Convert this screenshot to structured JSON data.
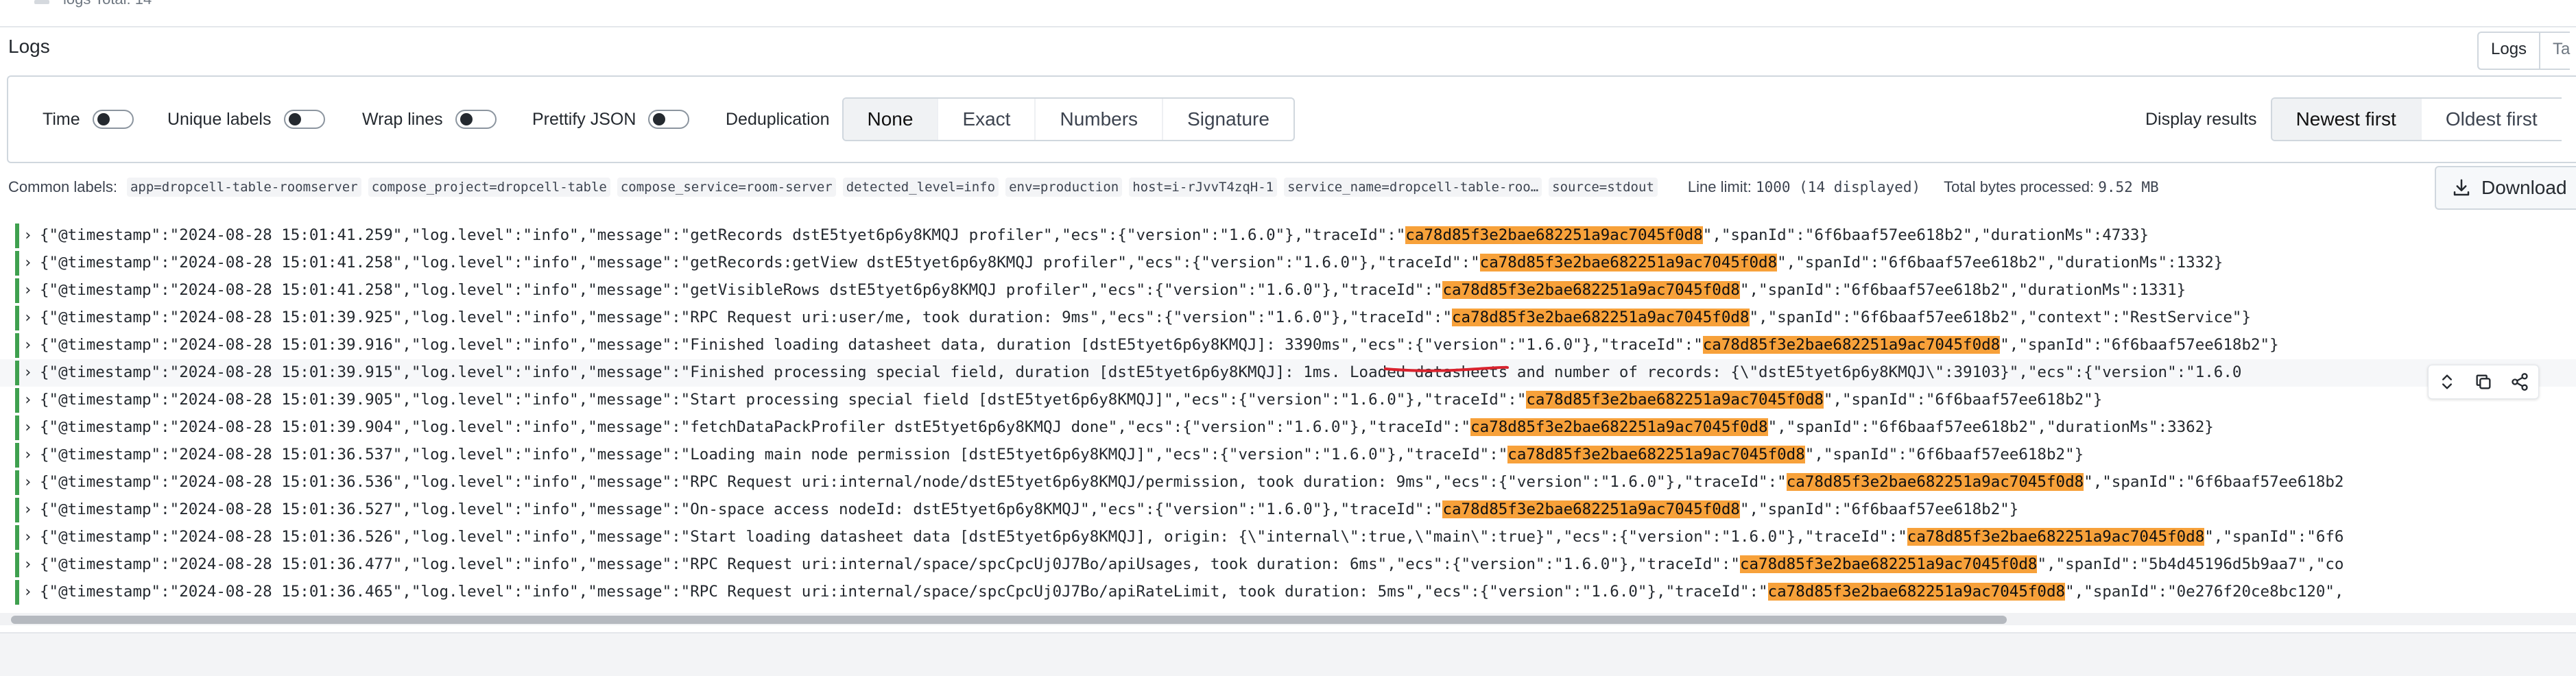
{
  "top_strip": {
    "legend_text": "logs   Total: 14"
  },
  "panel": {
    "title": "Logs"
  },
  "view_tabs": [
    "Logs",
    "Ta"
  ],
  "controls": {
    "time_label": "Time",
    "unique_labels_label": "Unique labels",
    "wrap_lines_label": "Wrap lines",
    "prettify_json_label": "Prettify JSON",
    "dedup_label": "Deduplication",
    "dedup_options": [
      "None",
      "Exact",
      "Numbers",
      "Signature"
    ],
    "dedup_selected": "None",
    "display_results_label": "Display results",
    "sort_options": [
      "Newest first",
      "Oldest first"
    ],
    "sort_selected": "Newest first"
  },
  "common_labels": {
    "label": "Common labels:",
    "chips": [
      "app=dropcell-table-roomserver",
      "compose_project=dropcell-table",
      "compose_service=room-server",
      "detected_level=info",
      "env=production",
      "host=i-rJvvT4zqH-1",
      "service_name=dropcell-table-roo…",
      "source=stdout"
    ],
    "line_limit_label": "Line limit:",
    "line_limit_value": "1000 (14 displayed)",
    "bytes_label": "Total bytes processed:",
    "bytes_value": "9.52 MB"
  },
  "download_label": "Download",
  "highlight_color": "#f7a13a",
  "log_lines": [
    {
      "before": "{\"@timestamp\":\"2024-08-28 15:01:41.259\",\"log.level\":\"info\",\"message\":\"getRecords dstE5tyet6p6y8KMQJ profiler\",\"ecs\":{\"version\":\"1.6.0\"},\"traceId\":\"",
      "hl": "ca78d85f3e2bae682251a9ac7045f0d8",
      "after": "\",\"spanId\":\"6f6baaf57ee618b2\",\"durationMs\":4733}"
    },
    {
      "before": "{\"@timestamp\":\"2024-08-28 15:01:41.258\",\"log.level\":\"info\",\"message\":\"getRecords:getView dstE5tyet6p6y8KMQJ profiler\",\"ecs\":{\"version\":\"1.6.0\"},\"traceId\":\"",
      "hl": "ca78d85f3e2bae682251a9ac7045f0d8",
      "after": "\",\"spanId\":\"6f6baaf57ee618b2\",\"durationMs\":1332}"
    },
    {
      "before": "{\"@timestamp\":\"2024-08-28 15:01:41.258\",\"log.level\":\"info\",\"message\":\"getVisibleRows dstE5tyet6p6y8KMQJ profiler\",\"ecs\":{\"version\":\"1.6.0\"},\"traceId\":\"",
      "hl": "ca78d85f3e2bae682251a9ac7045f0d8",
      "after": "\",\"spanId\":\"6f6baaf57ee618b2\",\"durationMs\":1331}"
    },
    {
      "before": "{\"@timestamp\":\"2024-08-28 15:01:39.925\",\"log.level\":\"info\",\"message\":\"RPC Request uri:user/me, took duration: 9ms\",\"ecs\":{\"version\":\"1.6.0\"},\"traceId\":\"",
      "hl": "ca78d85f3e2bae682251a9ac7045f0d8",
      "after": "\",\"spanId\":\"6f6baaf57ee618b2\",\"context\":\"RestService\"}"
    },
    {
      "before": "{\"@timestamp\":\"2024-08-28 15:01:39.916\",\"log.level\":\"info\",\"message\":\"Finished loading datasheet data, duration [dstE5tyet6p6y8KMQJ]: 3390ms\",\"ecs\":{\"version\":\"1.6.0\"},\"traceId\":\"",
      "hl": "ca78d85f3e2bae682251a9ac7045f0d8",
      "after": "\",\"spanId\":\"6f6baaf57ee618b2\"}"
    },
    {
      "before": "{\"@timestamp\":\"2024-08-28 15:01:39.915\",\"log.level\":\"info\",\"message\":\"Finished processing special field, duration [dstE5tyet6p6y8KMQJ]: 1ms. Loaded datasheets and number of records: {\\\"dstE5tyet6p6y8KMQJ\\\":39103}\",\"ecs\":{\"version\":\"1.6.0",
      "hl": "",
      "after": ""
    },
    {
      "before": "{\"@timestamp\":\"2024-08-28 15:01:39.905\",\"log.level\":\"info\",\"message\":\"Start processing special field [dstE5tyet6p6y8KMQJ]\",\"ecs\":{\"version\":\"1.6.0\"},\"traceId\":\"",
      "hl": "ca78d85f3e2bae682251a9ac7045f0d8",
      "after": "\",\"spanId\":\"6f6baaf57ee618b2\"}"
    },
    {
      "before": "{\"@timestamp\":\"2024-08-28 15:01:39.904\",\"log.level\":\"info\",\"message\":\"fetchDataPackProfiler dstE5tyet6p6y8KMQJ done\",\"ecs\":{\"version\":\"1.6.0\"},\"traceId\":\"",
      "hl": "ca78d85f3e2bae682251a9ac7045f0d8",
      "after": "\",\"spanId\":\"6f6baaf57ee618b2\",\"durationMs\":3362}"
    },
    {
      "before": "{\"@timestamp\":\"2024-08-28 15:01:36.537\",\"log.level\":\"info\",\"message\":\"Loading main node permission [dstE5tyet6p6y8KMQJ]\",\"ecs\":{\"version\":\"1.6.0\"},\"traceId\":\"",
      "hl": "ca78d85f3e2bae682251a9ac7045f0d8",
      "after": "\",\"spanId\":\"6f6baaf57ee618b2\"}"
    },
    {
      "before": "{\"@timestamp\":\"2024-08-28 15:01:36.536\",\"log.level\":\"info\",\"message\":\"RPC Request uri:internal/node/dstE5tyet6p6y8KMQJ/permission, took duration: 9ms\",\"ecs\":{\"version\":\"1.6.0\"},\"traceId\":\"",
      "hl": "ca78d85f3e2bae682251a9ac7045f0d8",
      "after": "\",\"spanId\":\"6f6baaf57ee618b2"
    },
    {
      "before": "{\"@timestamp\":\"2024-08-28 15:01:36.527\",\"log.level\":\"info\",\"message\":\"On-space access nodeId: dstE5tyet6p6y8KMQJ\",\"ecs\":{\"version\":\"1.6.0\"},\"traceId\":\"",
      "hl": "ca78d85f3e2bae682251a9ac7045f0d8",
      "after": "\",\"spanId\":\"6f6baaf57ee618b2\"}"
    },
    {
      "before": "{\"@timestamp\":\"2024-08-28 15:01:36.526\",\"log.level\":\"info\",\"message\":\"Start loading datasheet data [dstE5tyet6p6y8KMQJ], origin: {\\\"internal\\\":true,\\\"main\\\":true}\",\"ecs\":{\"version\":\"1.6.0\"},\"traceId\":\"",
      "hl": "ca78d85f3e2bae682251a9ac7045f0d8",
      "after": "\",\"spanId\":\"6f6"
    },
    {
      "before": "{\"@timestamp\":\"2024-08-28 15:01:36.477\",\"log.level\":\"info\",\"message\":\"RPC Request uri:internal/space/spcCpcUj0J7Bo/apiUsages, took duration: 6ms\",\"ecs\":{\"version\":\"1.6.0\"},\"traceId\":\"",
      "hl": "ca78d85f3e2bae682251a9ac7045f0d8",
      "after": "\",\"spanId\":\"5b4d45196d5b9aa7\",\"co"
    },
    {
      "before": "{\"@timestamp\":\"2024-08-28 15:01:36.465\",\"log.level\":\"info\",\"message\":\"RPC Request uri:internal/space/spcCpcUj0J7Bo/apiRateLimit, took duration: 5ms\",\"ecs\":{\"version\":\"1.6.0\"},\"traceId\":\"",
      "hl": "ca78d85f3e2bae682251a9ac7045f0d8",
      "after": "\",\"spanId\":\"0e276f20ce8bc120\","
    }
  ]
}
